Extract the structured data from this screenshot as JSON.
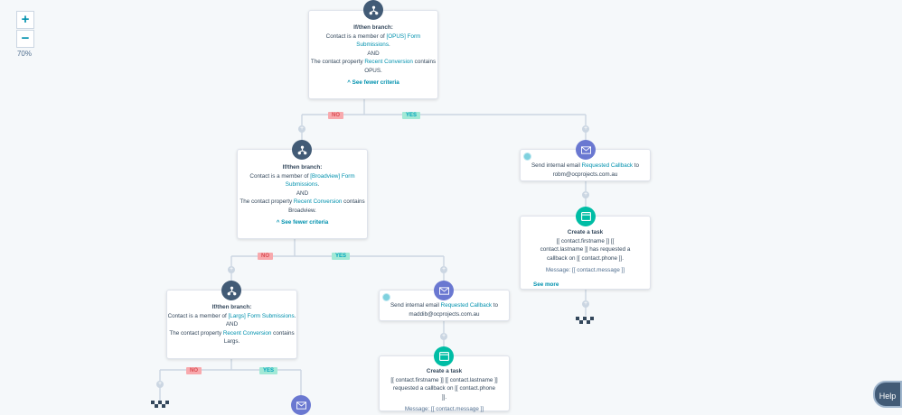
{
  "zoom": {
    "plus_label": "+",
    "minus_label": "−",
    "level": "70%"
  },
  "branch1": {
    "title": "If/then branch:",
    "line1_pre": "Contact is a member of ",
    "line1_link": "[OPUS] Form Submissions",
    "line1_post": ".",
    "and": "AND",
    "line2_pre": "The contact property ",
    "line2_link": "Recent Conversion",
    "line2_post": " contains OPUS.",
    "fewer": "See fewer criteria"
  },
  "branch2": {
    "title": "If/then branch:",
    "line1_pre": "Contact is a member of ",
    "line1_link": "[Broadview] Form Submissions",
    "line1_post": ".",
    "and": "AND",
    "line2_pre": "The contact property ",
    "line2_link": "Recent Conversion",
    "line2_post": " contains Broadview.",
    "fewer": "See fewer criteria"
  },
  "branch3": {
    "title": "If/then branch:",
    "line1_pre": "Contact is a member of ",
    "line1_link": "[Largs] Form Submissions",
    "line1_post": ".",
    "and": "AND",
    "line2_pre": "The contact property ",
    "line2_link": "Recent Conversion",
    "line2_post": " contains Largs."
  },
  "labels": {
    "no": "NO",
    "yes": "YES"
  },
  "email_right": {
    "pre": "Send internal email ",
    "link": "Requested Callback",
    "post": " to",
    "to": "robm@ocprojects.com.au"
  },
  "task_right": {
    "title": "Create a task",
    "body": "[[ contact.firstname ]] [[ contact.lastname ]] has requested a callback on [[ contact.phone ]].",
    "message": "Message: [[ contact.message ]]",
    "see_more": "See more"
  },
  "email_mid": {
    "pre": "Send internal email ",
    "link": "Requested Callback",
    "post": " to",
    "to": "maddib@ocprojects.com.au"
  },
  "task_mid": {
    "title": "Create a task",
    "body": "[[ contact.firstname ]] [[ contact.lastname ]] requested a callback on [[ contact.phone ]].",
    "message": "Message: [[ contact.message ]]"
  },
  "help": {
    "label": "Help"
  },
  "icons": {
    "branch": "branch-icon",
    "email": "envelope-icon",
    "task": "task-icon",
    "end": "checkered-flag-icon",
    "plus": "plus-icon"
  },
  "colors": {
    "branch": "#425b76",
    "email": "#6a78d1",
    "task": "#00bda5",
    "no_bg": "#f8a9ad",
    "yes_bg": "#a2e9d6",
    "link": "#0091ae"
  }
}
